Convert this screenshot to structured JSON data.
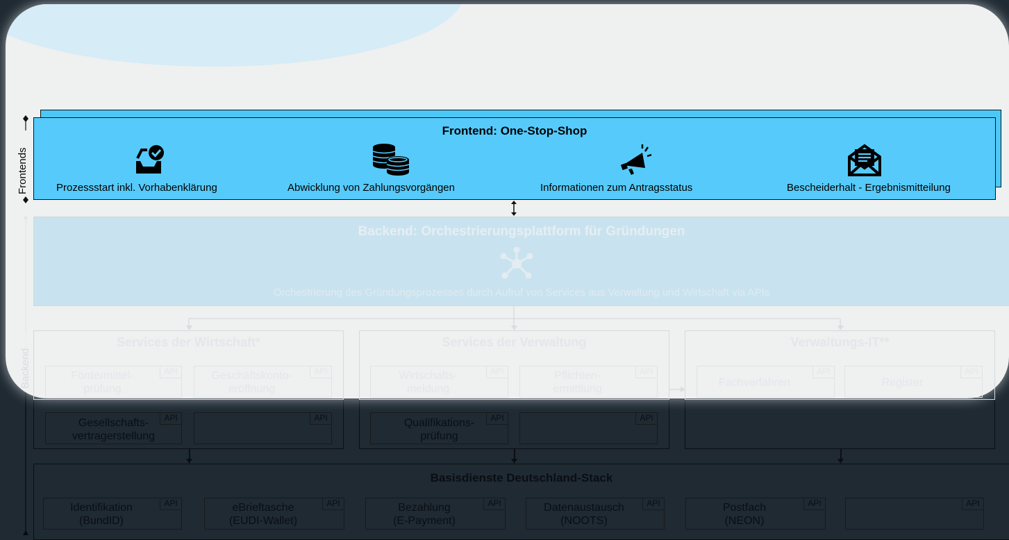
{
  "axis": {
    "frontends": "Frontends",
    "backend": "Backend"
  },
  "frontend": {
    "title": "Frontend: One-Stop-Shop",
    "items": [
      {
        "label": "Prozessstart inkl. Vorhabenklärung",
        "icon": "inbox-check-icon"
      },
      {
        "label": "Abwicklung von Zahlungsvorgängen",
        "icon": "coins-icon"
      },
      {
        "label": "Informationen zum Antragsstatus",
        "icon": "megaphone-icon"
      },
      {
        "label": "Bescheiderhalt - Ergebnismitteilung",
        "icon": "mail-document-icon"
      }
    ]
  },
  "backend": {
    "title": "Backend: Orchestrierungsplattform für Gründungen",
    "icon": "network-hub-icon",
    "description": "Orchestrierung des Gründungsprozesses durch Aufruf von Services aus Verwaltung und Wirtschaft via APIs"
  },
  "api_label": "API",
  "services": [
    {
      "title": "Services der Wirtschaft*",
      "items": [
        "Fördermittel-\nprüfung",
        "Geschäftskonto-\neröffnung",
        "Gesellschafts-\nvertragerstellung",
        "…"
      ]
    },
    {
      "title": "Services der Verwaltung",
      "items": [
        "Wirtschafts-\nmeldung",
        "Pflichten-\nermittlung",
        "Qualifikations-\nprüfung",
        "…"
      ]
    },
    {
      "title": "Verwaltungs-IT**",
      "items": [
        "Fachverfahren",
        "Register"
      ]
    }
  ],
  "basis": {
    "title": "Basisdienste Deutschland-Stack",
    "items": [
      "Identifikation\n(BundID)",
      "eBrieftasche\n(EUDI-Wallet)",
      "Bezahlung\n(E-Payment)",
      "Datenaustausch\n(NOOTS)",
      "Postfach\n(NEON)",
      "…"
    ]
  }
}
